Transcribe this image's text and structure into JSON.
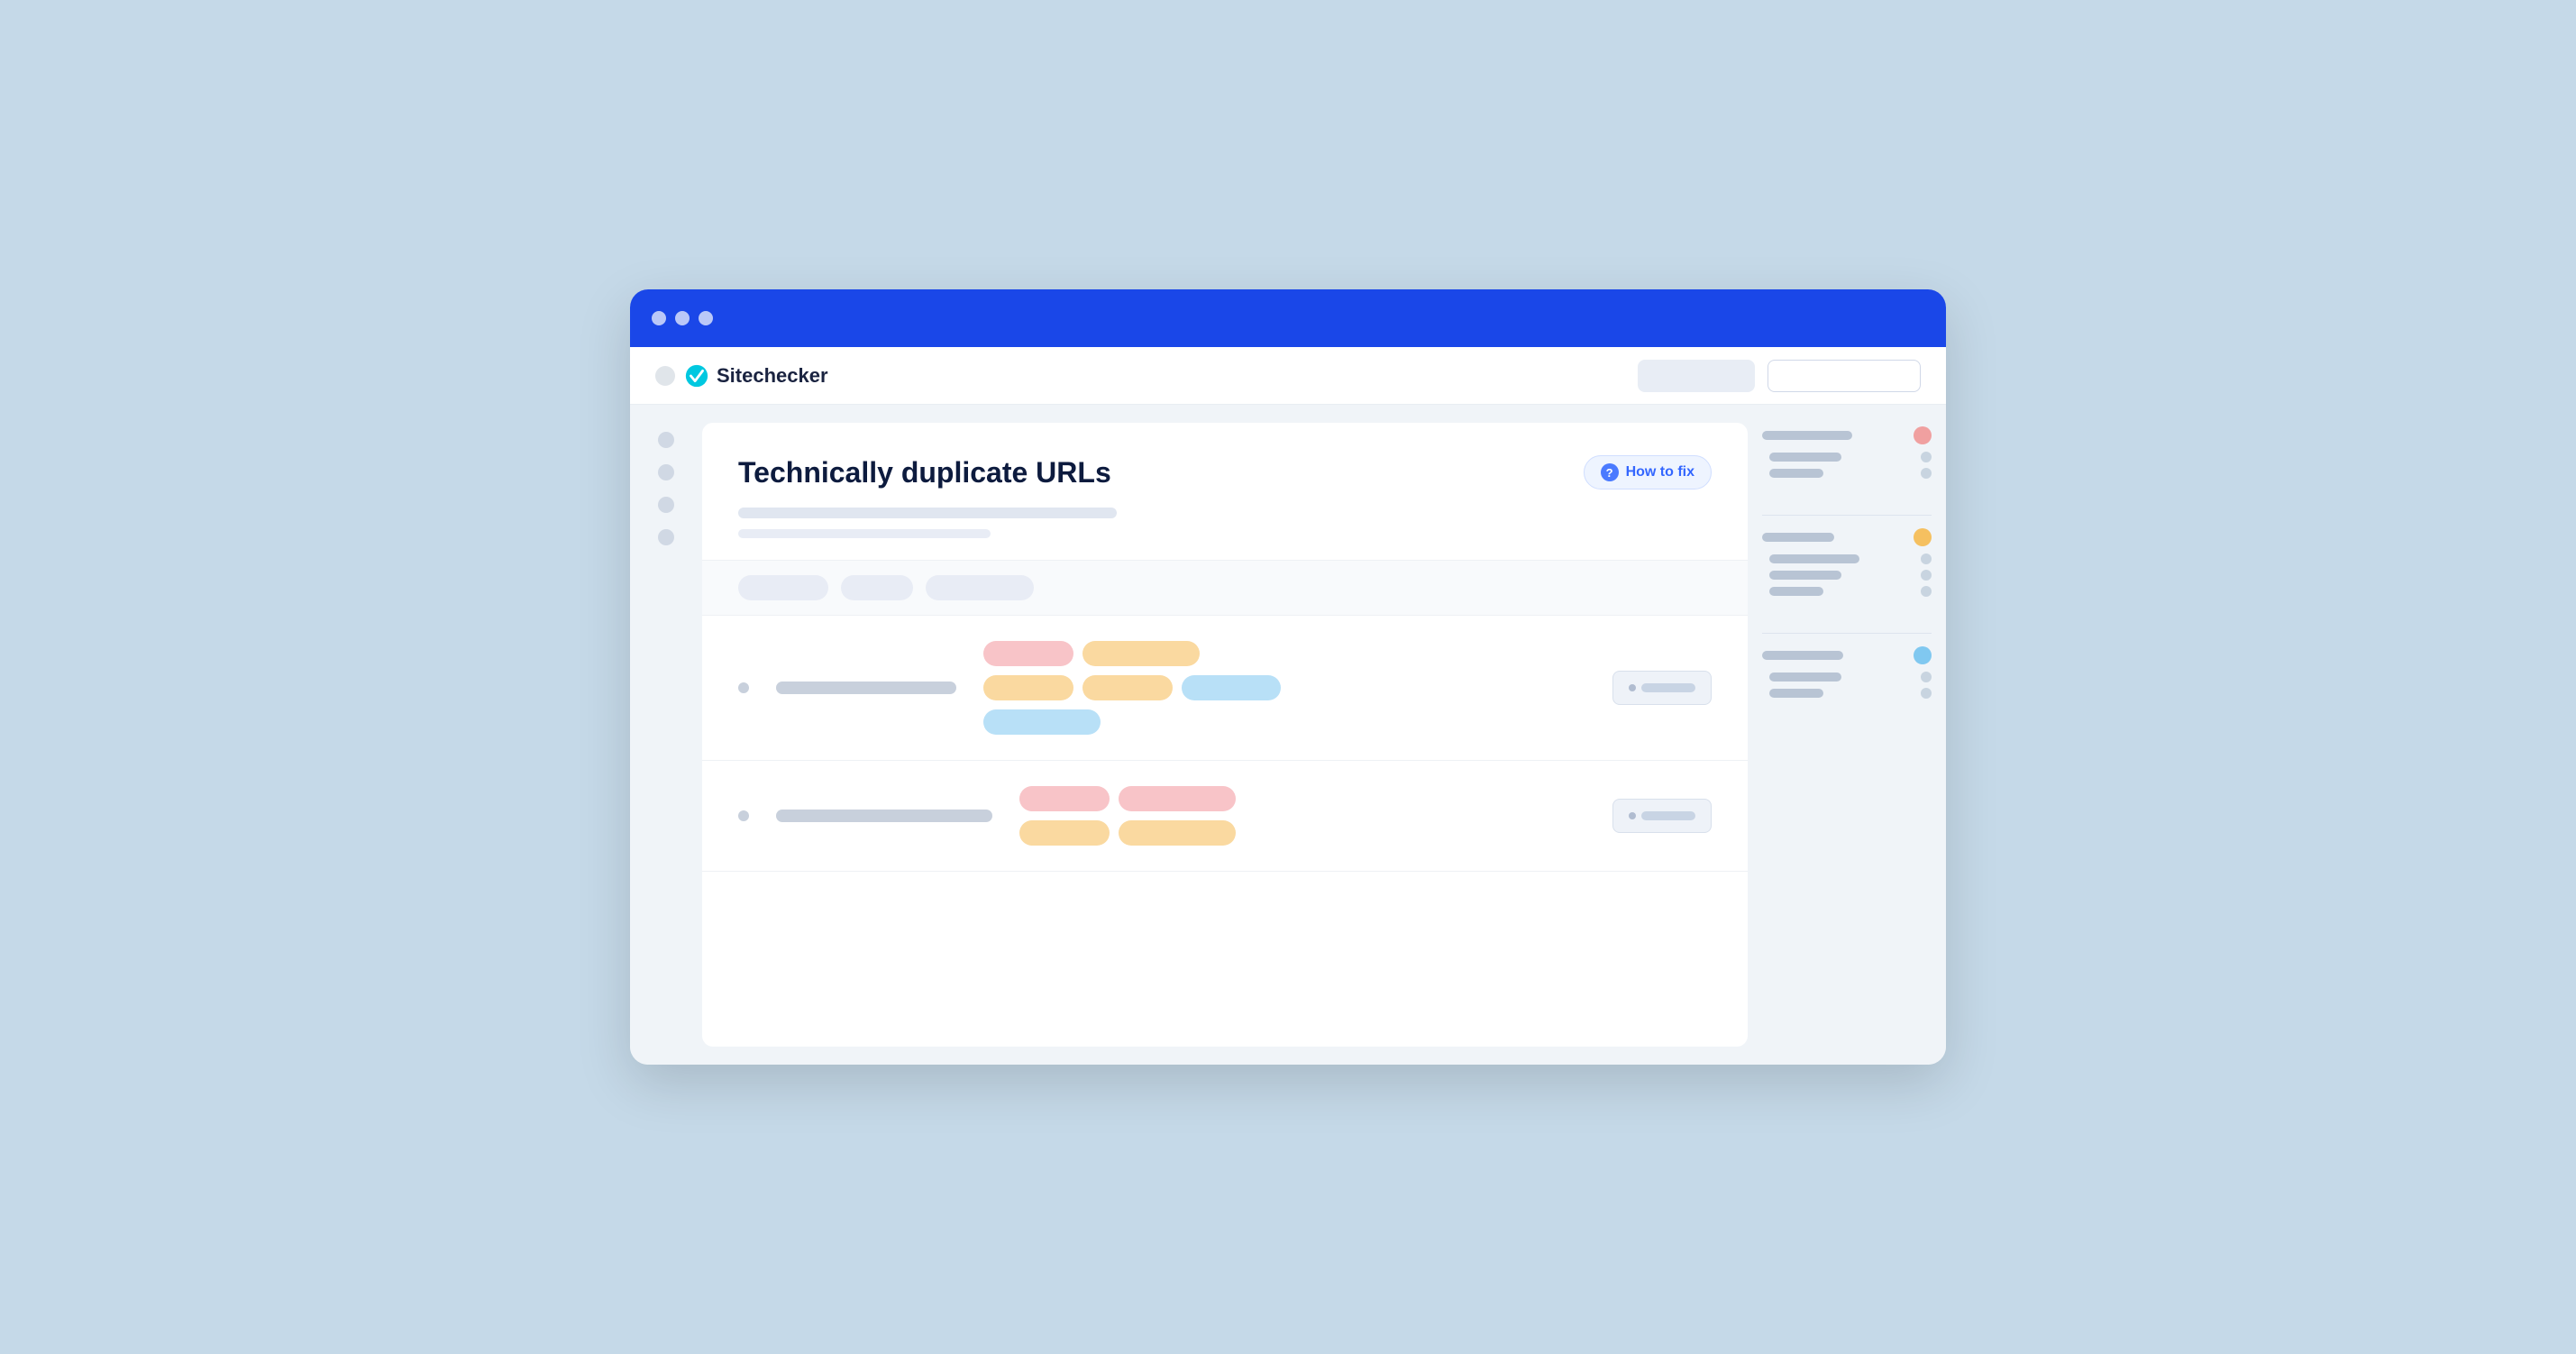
{
  "browser": {
    "title_bar_color": "#1a47e8",
    "dots": [
      "white",
      "white",
      "white"
    ]
  },
  "navbar": {
    "logo_text": "Sitechecker",
    "btn1_label": "",
    "btn2_label": ""
  },
  "page": {
    "title": "Technically duplicate URLs",
    "how_to_fix_label": "How to fix",
    "how_to_fix_icon": "?",
    "desc_line1": "",
    "desc_line2": ""
  },
  "rows": [
    {
      "url_width": 200,
      "tags": [
        {
          "color": "pink",
          "size": "s"
        },
        {
          "color": "orange",
          "size": "m"
        },
        {
          "color": "orange",
          "size": "s"
        },
        {
          "color": "orange",
          "size": "s"
        },
        {
          "color": "blue",
          "size": "s"
        },
        {
          "color": "blue",
          "size": "m"
        }
      ]
    },
    {
      "url_width": 240,
      "tags": [
        {
          "color": "pink",
          "size": "s"
        },
        {
          "color": "pink",
          "size": "m"
        },
        {
          "color": "orange",
          "size": "s"
        },
        {
          "color": "orange",
          "size": "s"
        }
      ]
    }
  ],
  "sidebar_right": {
    "sections": [
      {
        "items": [
          {
            "label_width": 100,
            "badge": "red"
          },
          {
            "label_width": 80,
            "badge": null
          },
          {
            "label_width": 60,
            "badge": null
          }
        ]
      },
      {
        "items": [
          {
            "label_width": 80,
            "badge": "orange"
          },
          {
            "label_width": 100,
            "badge": null
          },
          {
            "label_width": 60,
            "badge": null
          },
          {
            "label_width": 80,
            "badge": null
          }
        ]
      },
      {
        "items": [
          {
            "label_width": 90,
            "badge": "blue"
          },
          {
            "label_width": 70,
            "badge": null
          },
          {
            "label_width": 50,
            "badge": null
          }
        ]
      }
    ]
  }
}
